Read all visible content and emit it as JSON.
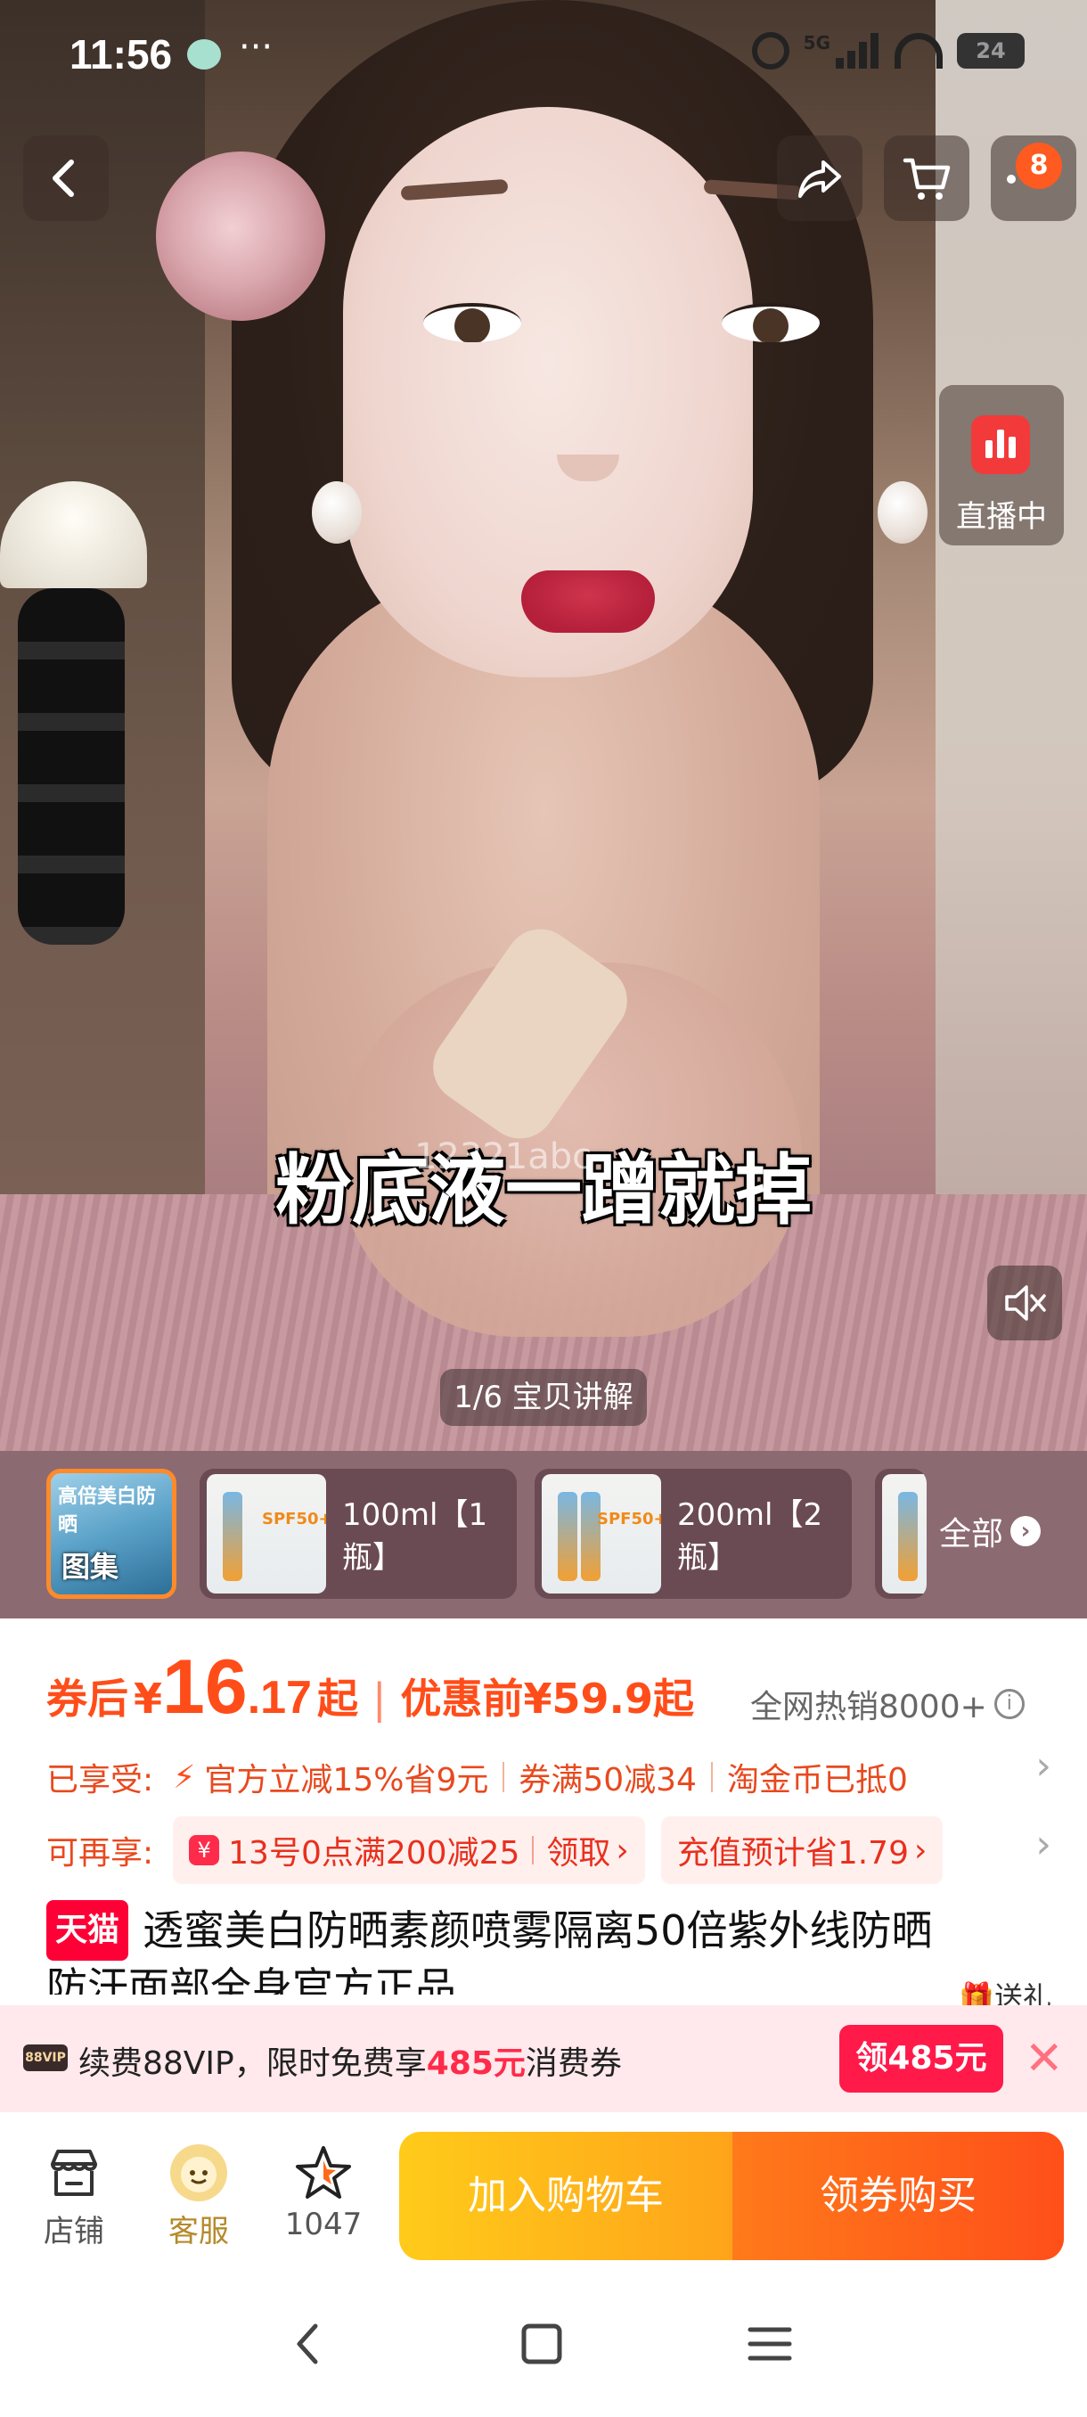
{
  "status_bar": {
    "time": "11:56",
    "dots": "···",
    "network": "5G",
    "battery": "24"
  },
  "media": {
    "subtitle": "粉底液一蹭就掉",
    "watermark": "12321abc",
    "live_label": "直播中",
    "counter": "1/6 宝贝讲解",
    "cart_badge": "8"
  },
  "thumbnails": {
    "gallery_label": "图集",
    "gallery_caption": "高倍美白防晒",
    "sku_items": [
      {
        "label": "100ml【1瓶】",
        "spf": "SPF50+"
      },
      {
        "label": "200ml【2瓶】",
        "spf": "SPF50+"
      }
    ],
    "all_label": "全部"
  },
  "price": {
    "after_coupon": "券后",
    "currency": "¥",
    "integer": "16",
    "decimal": ".17",
    "suffix": "起",
    "before_label": "优惠前¥59.9起",
    "hot_sales": "全网热销8000+",
    "enjoyed_label": "已享受:",
    "enjoyed_items": [
      "官方立减15%省9元",
      "券满50减34",
      "淘金币已抵0"
    ],
    "more_label": "可再享:",
    "coupon_text": "13号0点满200减25",
    "coupon_action": "领取",
    "recharge_text": "充值预计省1.79"
  },
  "product": {
    "store_badge": "天猫",
    "title_line1": "透蜜美白防晒素颜喷雾隔离50倍紫外线防晒",
    "title_line2": "防汗面部全身官方正品",
    "gift_label": "送礼"
  },
  "vip_banner": {
    "tag": "88VIP",
    "text_prefix": "续费88VIP，限时免费享",
    "highlight": "485元",
    "text_suffix": "消费券",
    "button": "领485元"
  },
  "action_bar": {
    "store": "店铺",
    "service": "客服",
    "favorites": "1047",
    "add_cart": "加入购物车",
    "buy": "领券购买"
  },
  "colors": {
    "accent": "#ff4d1a",
    "tmall_red": "#ff0036",
    "cart_yellow": "#ffcb1a",
    "buy_orange": "#ff4f1a"
  }
}
